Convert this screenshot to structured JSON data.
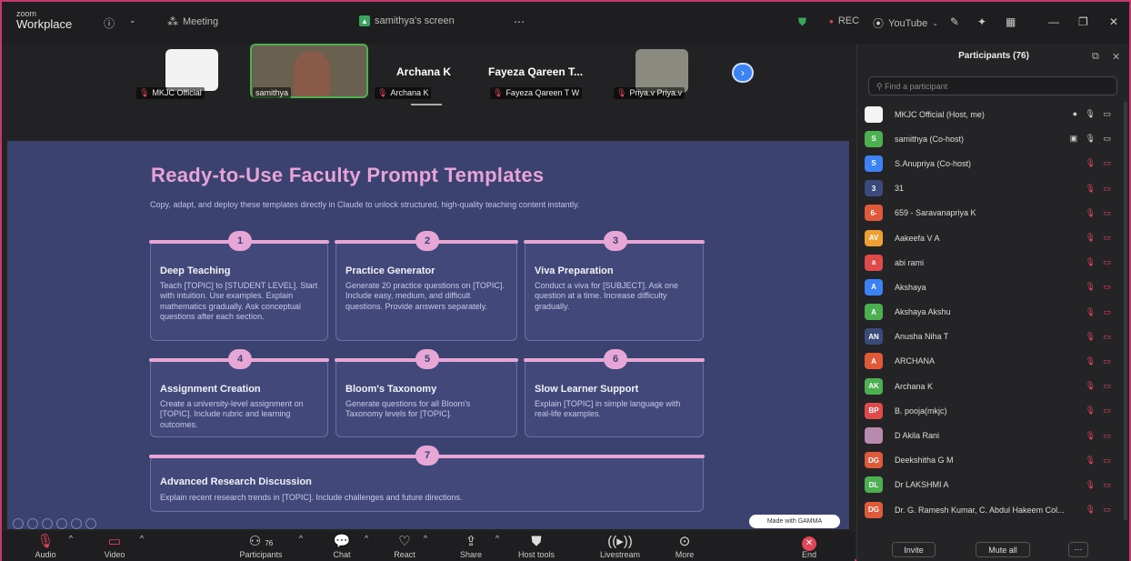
{
  "app": {
    "brand_small": "zoom",
    "brand_name": "Workplace"
  },
  "topbar": {
    "meeting_label": "Meeting",
    "screen_label": "samithya's screen",
    "rec_label": "REC",
    "youtube_label": "YouTube"
  },
  "strip": {
    "tiles": [
      {
        "label": "MKJC Official"
      },
      {
        "label": "samithya"
      },
      {
        "big": "Archana K",
        "label": "Archana K"
      },
      {
        "big": "Fayeza Qareen T...",
        "label": "Fayeza Qareen T W"
      },
      {
        "label": "Priya.v Priya.v"
      }
    ]
  },
  "slide": {
    "title": "Ready-to-Use Faculty Prompt Templates",
    "subtitle": "Copy, adapt, and deploy these templates directly in Claude to unlock structured, high-quality teaching content instantly.",
    "cards": [
      {
        "num": "1",
        "title": "Deep Teaching",
        "body": "Teach [TOPIC] to [STUDENT LEVEL]. Start with intuition. Use examples. Explain mathematics gradually. Ask conceptual questions after each section."
      },
      {
        "num": "2",
        "title": "Practice Generator",
        "body": "Generate 20 practice questions on [TOPIC]. Include easy, medium, and difficult questions. Provide answers separately."
      },
      {
        "num": "3",
        "title": "Viva Preparation",
        "body": "Conduct a viva for [SUBJECT]. Ask one question at a time. Increase difficulty gradually."
      },
      {
        "num": "4",
        "title": "Assignment Creation",
        "body": "Create a university-level assignment on [TOPIC]. Include rubric and learning outcomes."
      },
      {
        "num": "5",
        "title": "Bloom's Taxonomy",
        "body": "Generate questions for all Bloom's Taxonomy levels for [TOPIC]."
      },
      {
        "num": "6",
        "title": "Slow Learner Support",
        "body": "Explain [TOPIC] in simple language with real-life examples."
      },
      {
        "num": "7",
        "title": "Advanced Research Discussion",
        "body": "Explain recent research trends in [TOPIC]. Include challenges and future directions."
      }
    ],
    "badge": "Made with GAMMA"
  },
  "toolbar": {
    "audio": "Audio",
    "video": "Video",
    "participants": "Participants",
    "participants_count": "76",
    "chat": "Chat",
    "react": "React",
    "share": "Share",
    "host_tools": "Host tools",
    "livestream": "Livestream",
    "more": "More",
    "end": "End"
  },
  "panel": {
    "title": "Participants (76)",
    "search_placeholder": "Find a participant",
    "participants": [
      {
        "initials": "",
        "name": "MKJC Official (Host, me)",
        "color": "#f4f4f4"
      },
      {
        "initials": "S",
        "name": "samithya (Co-host)",
        "color": "#4caf50"
      },
      {
        "initials": "S",
        "name": "S.Anupriya  (Co-host)",
        "color": "#3b82f6"
      },
      {
        "initials": "3",
        "name": "31",
        "color": "#3a4a7a"
      },
      {
        "initials": "6-",
        "name": "659 - Saravanapriya K",
        "color": "#e05a3a"
      },
      {
        "initials": "AV",
        "name": "Aakeefa V A",
        "color": "#f0a030"
      },
      {
        "initials": "a",
        "name": "abi rami",
        "color": "#e04a4a"
      },
      {
        "initials": "A",
        "name": "Akshaya",
        "color": "#3b82f6"
      },
      {
        "initials": "A",
        "name": "Akshaya Akshu",
        "color": "#4caf50"
      },
      {
        "initials": "AN",
        "name": "Anusha Niha T",
        "color": "#3a4a7a"
      },
      {
        "initials": "A",
        "name": "ARCHANA",
        "color": "#e05a3a"
      },
      {
        "initials": "AK",
        "name": "Archana K",
        "color": "#4caf50"
      },
      {
        "initials": "BP",
        "name": "B. pooja(mkjc)",
        "color": "#e04a4a"
      },
      {
        "initials": "",
        "name": "D Akila Rani",
        "color": "#b98ab0"
      },
      {
        "initials": "DG",
        "name": "Deekshitha G M",
        "color": "#e05a3a"
      },
      {
        "initials": "DL",
        "name": "Dr LAKSHMI A",
        "color": "#4caf50"
      },
      {
        "initials": "DG",
        "name": "Dr. G. Ramesh Kumar, C. Abdul Hakeem Col...",
        "color": "#e05a3a"
      }
    ],
    "invite": "Invite",
    "mute_all": "Mute all"
  }
}
